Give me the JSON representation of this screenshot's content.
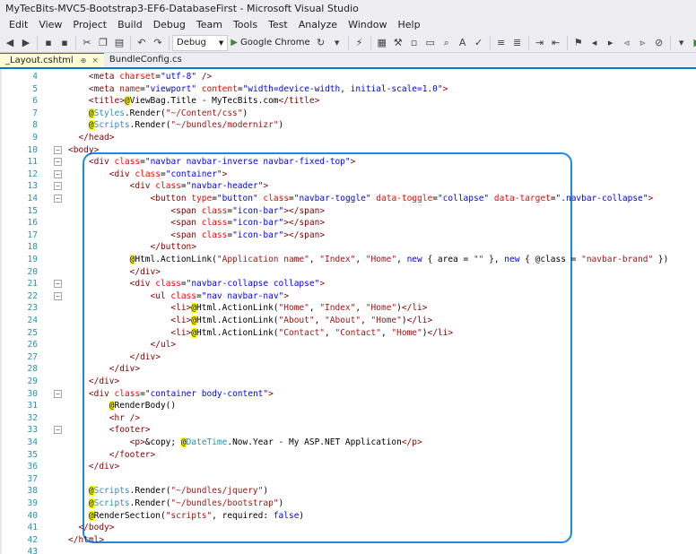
{
  "window": {
    "title": "MyTecBits-MVC5-Bootstrap3-EF6-DatabaseFirst - Microsoft Visual Studio"
  },
  "menu": [
    "Edit",
    "View",
    "Project",
    "Build",
    "Debug",
    "Team",
    "Tools",
    "Test",
    "Analyze",
    "Window",
    "Help"
  ],
  "toolbar": {
    "config_value": "Debug",
    "run_label": "Google Chrome"
  },
  "tabs": [
    {
      "label": "_Layout.cshtml",
      "active": true,
      "pin": "⊕",
      "close": "×"
    },
    {
      "label": "BundleConfig.cs",
      "active": false
    }
  ],
  "lines": [
    {
      "n": "4",
      "t": [
        [
          "tag",
          "<"
        ],
        [
          "tag",
          "meta"
        ],
        [
          "plain",
          " "
        ],
        [
          "attr",
          "charset"
        ],
        [
          "plain",
          "="
        ],
        [
          "val",
          "\"utf-8\""
        ],
        [
          "plain",
          " "
        ],
        [
          "tag",
          "/>"
        ]
      ]
    },
    {
      "n": "5",
      "t": [
        [
          "tag",
          "<meta"
        ],
        [
          "plain",
          " "
        ],
        [
          "attr",
          "name"
        ],
        [
          "plain",
          "="
        ],
        [
          "val",
          "\"viewport\""
        ],
        [
          "plain",
          " "
        ],
        [
          "attr",
          "content"
        ],
        [
          "plain",
          "="
        ],
        [
          "val",
          "\"width=device-width, initial-scale=1.0\""
        ],
        [
          "tag",
          ">"
        ]
      ]
    },
    {
      "n": "6",
      "t": [
        [
          "tag",
          "<title>"
        ],
        [
          "razor",
          "@"
        ],
        [
          "plain",
          "ViewBag.Title - MyTecBits.com"
        ],
        [
          "tag",
          "</title>"
        ]
      ]
    },
    {
      "n": "7",
      "t": [
        [
          "razor",
          "@"
        ],
        [
          "type",
          "Styles"
        ],
        [
          "plain",
          ".Render("
        ],
        [
          "str",
          "\"~/Content/css\""
        ],
        [
          "plain",
          ")"
        ]
      ]
    },
    {
      "n": "8",
      "t": [
        [
          "razor",
          "@"
        ],
        [
          "type",
          "Scripts"
        ],
        [
          "plain",
          ".Render("
        ],
        [
          "str",
          "\"~/bundles/modernizr\""
        ],
        [
          "plain",
          ")"
        ]
      ]
    },
    {
      "n": "9",
      "t": [
        [
          "tag",
          "</head>"
        ]
      ]
    },
    {
      "n": "10",
      "t": [
        [
          "tag",
          "<body>"
        ]
      ]
    },
    {
      "n": "11",
      "t": [
        [
          "tag",
          "<div"
        ],
        [
          "plain",
          " "
        ],
        [
          "attr",
          "class"
        ],
        [
          "plain",
          "="
        ],
        [
          "val",
          "\"navbar navbar-inverse navbar-fixed-top\""
        ],
        [
          "tag",
          ">"
        ]
      ]
    },
    {
      "n": "12",
      "t": [
        [
          "tag",
          "<div"
        ],
        [
          "plain",
          " "
        ],
        [
          "attr",
          "class"
        ],
        [
          "plain",
          "="
        ],
        [
          "val",
          "\"container\""
        ],
        [
          "tag",
          ">"
        ]
      ]
    },
    {
      "n": "13",
      "t": [
        [
          "tag",
          "<div"
        ],
        [
          "plain",
          " "
        ],
        [
          "attr",
          "class"
        ],
        [
          "plain",
          "="
        ],
        [
          "val",
          "\"navbar-header\""
        ],
        [
          "tag",
          ">"
        ]
      ]
    },
    {
      "n": "14",
      "t": [
        [
          "tag",
          "<button"
        ],
        [
          "plain",
          " "
        ],
        [
          "attr",
          "type"
        ],
        [
          "plain",
          "="
        ],
        [
          "val",
          "\"button\""
        ],
        [
          "plain",
          " "
        ],
        [
          "attr",
          "class"
        ],
        [
          "plain",
          "="
        ],
        [
          "val",
          "\"navbar-toggle\""
        ],
        [
          "plain",
          " "
        ],
        [
          "attr",
          "data-toggle"
        ],
        [
          "plain",
          "="
        ],
        [
          "val",
          "\"collapse\""
        ],
        [
          "plain",
          " "
        ],
        [
          "attr",
          "data-target"
        ],
        [
          "plain",
          "="
        ],
        [
          "val",
          "\".navbar-collapse\""
        ],
        [
          "tag",
          ">"
        ]
      ]
    },
    {
      "n": "15",
      "t": [
        [
          "tag",
          "<span"
        ],
        [
          "plain",
          " "
        ],
        [
          "attr",
          "class"
        ],
        [
          "plain",
          "="
        ],
        [
          "val",
          "\"icon-bar\""
        ],
        [
          "tag",
          "></span>"
        ]
      ]
    },
    {
      "n": "16",
      "t": [
        [
          "tag",
          "<span"
        ],
        [
          "plain",
          " "
        ],
        [
          "attr",
          "class"
        ],
        [
          "plain",
          "="
        ],
        [
          "val",
          "\"icon-bar\""
        ],
        [
          "tag",
          "></span>"
        ]
      ]
    },
    {
      "n": "17",
      "t": [
        [
          "tag",
          "<span"
        ],
        [
          "plain",
          " "
        ],
        [
          "attr",
          "class"
        ],
        [
          "plain",
          "="
        ],
        [
          "val",
          "\"icon-bar\""
        ],
        [
          "tag",
          "></span>"
        ]
      ]
    },
    {
      "n": "18",
      "t": [
        [
          "tag",
          "</button>"
        ]
      ]
    },
    {
      "n": "19",
      "t": [
        [
          "razor",
          "@"
        ],
        [
          "plain",
          "Html.ActionLink("
        ],
        [
          "str",
          "\"Application name\""
        ],
        [
          "plain",
          ", "
        ],
        [
          "str",
          "\"Index\""
        ],
        [
          "plain",
          ", "
        ],
        [
          "str",
          "\"Home\""
        ],
        [
          "plain",
          ", "
        ],
        [
          "kw",
          "new"
        ],
        [
          "plain",
          " { area = "
        ],
        [
          "str",
          "\"\""
        ],
        [
          "plain",
          " }, "
        ],
        [
          "kw",
          "new"
        ],
        [
          "plain",
          " { @class = "
        ],
        [
          "str",
          "\"navbar-brand\""
        ],
        [
          "plain",
          " })"
        ]
      ]
    },
    {
      "n": "20",
      "t": [
        [
          "tag",
          "</div>"
        ]
      ]
    },
    {
      "n": "21",
      "t": [
        [
          "tag",
          "<div"
        ],
        [
          "plain",
          " "
        ],
        [
          "attr",
          "class"
        ],
        [
          "plain",
          "="
        ],
        [
          "val",
          "\"navbar-collapse collapse\""
        ],
        [
          "tag",
          ">"
        ]
      ]
    },
    {
      "n": "22",
      "t": [
        [
          "tag",
          "<ul"
        ],
        [
          "plain",
          " "
        ],
        [
          "attr",
          "class"
        ],
        [
          "plain",
          "="
        ],
        [
          "val",
          "\"nav navbar-nav\""
        ],
        [
          "tag",
          ">"
        ]
      ]
    },
    {
      "n": "23",
      "t": [
        [
          "tag",
          "<li>"
        ],
        [
          "razor",
          "@"
        ],
        [
          "plain",
          "Html.ActionLink("
        ],
        [
          "str",
          "\"Home\""
        ],
        [
          "plain",
          ", "
        ],
        [
          "str",
          "\"Index\""
        ],
        [
          "plain",
          ", "
        ],
        [
          "str",
          "\"Home\""
        ],
        [
          "plain",
          ")"
        ],
        [
          "tag",
          "</li>"
        ]
      ]
    },
    {
      "n": "24",
      "t": [
        [
          "tag",
          "<li>"
        ],
        [
          "razor",
          "@"
        ],
        [
          "plain",
          "Html.ActionLink("
        ],
        [
          "str",
          "\"About\""
        ],
        [
          "plain",
          ", "
        ],
        [
          "str",
          "\"About\""
        ],
        [
          "plain",
          ", "
        ],
        [
          "str",
          "\"Home\""
        ],
        [
          "plain",
          ")"
        ],
        [
          "tag",
          "</li>"
        ]
      ]
    },
    {
      "n": "25",
      "t": [
        [
          "tag",
          "<li>"
        ],
        [
          "razor",
          "@"
        ],
        [
          "plain",
          "Html.ActionLink("
        ],
        [
          "str",
          "\"Contact\""
        ],
        [
          "plain",
          ", "
        ],
        [
          "str",
          "\"Contact\""
        ],
        [
          "plain",
          ", "
        ],
        [
          "str",
          "\"Home\""
        ],
        [
          "plain",
          ")"
        ],
        [
          "tag",
          "</li>"
        ]
      ]
    },
    {
      "n": "26",
      "t": [
        [
          "tag",
          "</ul>"
        ]
      ]
    },
    {
      "n": "27",
      "t": [
        [
          "tag",
          "</div>"
        ]
      ]
    },
    {
      "n": "28",
      "t": [
        [
          "tag",
          "</div>"
        ]
      ]
    },
    {
      "n": "29",
      "t": [
        [
          "tag",
          "</div>"
        ]
      ]
    },
    {
      "n": "30",
      "t": [
        [
          "tag",
          "<div"
        ],
        [
          "plain",
          " "
        ],
        [
          "attr",
          "class"
        ],
        [
          "plain",
          "="
        ],
        [
          "val",
          "\"container body-content\""
        ],
        [
          "tag",
          ">"
        ]
      ]
    },
    {
      "n": "31",
      "t": [
        [
          "razor",
          "@"
        ],
        [
          "plain",
          "RenderBody()"
        ]
      ]
    },
    {
      "n": "32",
      "t": [
        [
          "tag",
          "<hr"
        ],
        [
          "plain",
          " "
        ],
        [
          "tag",
          "/>"
        ]
      ]
    },
    {
      "n": "33",
      "t": [
        [
          "tag",
          "<footer>"
        ]
      ]
    },
    {
      "n": "34",
      "t": [
        [
          "tag",
          "<p>"
        ],
        [
          "plain",
          "&copy; "
        ],
        [
          "razor",
          "@"
        ],
        [
          "type",
          "DateTime"
        ],
        [
          "plain",
          ".Now.Year - My ASP.NET Application"
        ],
        [
          "tag",
          "</p>"
        ]
      ]
    },
    {
      "n": "35",
      "t": [
        [
          "tag",
          "</footer>"
        ]
      ]
    },
    {
      "n": "36",
      "t": [
        [
          "tag",
          "</div>"
        ]
      ]
    },
    {
      "n": "37",
      "t": []
    },
    {
      "n": "38",
      "t": [
        [
          "razor",
          "@"
        ],
        [
          "type",
          "Scripts"
        ],
        [
          "plain",
          ".Render("
        ],
        [
          "str",
          "\"~/bundles/jquery\""
        ],
        [
          "plain",
          ")"
        ]
      ]
    },
    {
      "n": "39",
      "t": [
        [
          "razor",
          "@"
        ],
        [
          "type",
          "Scripts"
        ],
        [
          "plain",
          ".Render("
        ],
        [
          "str",
          "\"~/bundles/bootstrap\""
        ],
        [
          "plain",
          ")"
        ]
      ]
    },
    {
      "n": "40",
      "t": [
        [
          "razor",
          "@"
        ],
        [
          "plain",
          "RenderSection("
        ],
        [
          "str",
          "\"scripts\""
        ],
        [
          "plain",
          ", required: "
        ],
        [
          "kw",
          "false"
        ],
        [
          "plain",
          ")"
        ]
      ]
    },
    {
      "n": "41",
      "t": [
        [
          "tag",
          "</body>"
        ]
      ]
    },
    {
      "n": "42",
      "t": [
        [
          "tag",
          "</html>"
        ]
      ]
    },
    {
      "n": "43",
      "t": []
    }
  ]
}
